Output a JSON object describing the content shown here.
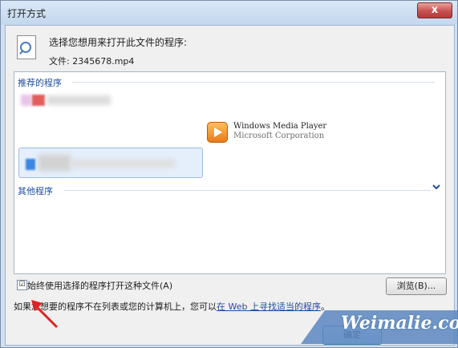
{
  "window": {
    "title": "打开方式",
    "close_label": "x"
  },
  "header": {
    "prompt": "选择您想用来打开此文件的程序:",
    "file_label": "文件: 2345678.mp4"
  },
  "list": {
    "recommended_label": "推荐的程序",
    "other_label": "其他程序",
    "expand_icon": "chevron-down-icon",
    "programs": [
      {
        "name": "Windows Media Player",
        "vendor": "Microsoft Corporation"
      }
    ]
  },
  "options": {
    "always_use_label": "始终使用选择的程序打开这种文件(A)",
    "always_use_checked": "☑",
    "browse_label": "浏览(B)...",
    "hint_prefix": "如果您想要的程序不在列表或您的计算机上，您可以",
    "hint_link": "在 Web 上寻找适当的程序",
    "hint_suffix": "。"
  },
  "footer": {
    "ok_label": "确定"
  },
  "watermark": {
    "text": "Weimalie.com"
  }
}
